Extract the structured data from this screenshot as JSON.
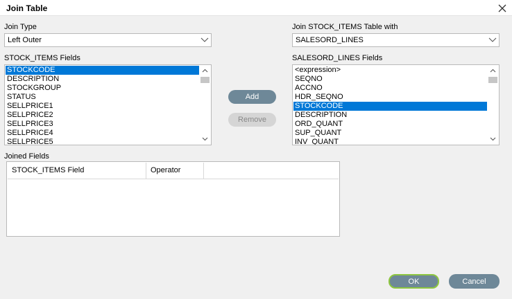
{
  "window": {
    "title": "Join Table",
    "close_icon": "close-icon"
  },
  "join_type": {
    "label": "Join Type",
    "value": "Left Outer"
  },
  "join_with": {
    "label": "Join STOCK_ITEMS Table with",
    "value": "SALESORD_LINES"
  },
  "left_fields": {
    "label": "STOCK_ITEMS Fields",
    "items": [
      "STOCKCODE",
      "DESCRIPTION",
      "STOCKGROUP",
      "STATUS",
      "SELLPRICE1",
      "SELLPRICE2",
      "SELLPRICE3",
      "SELLPRICE4",
      "SELLPRICE5"
    ],
    "selected_index": 0
  },
  "right_fields": {
    "label": "SALESORD_LINES Fields",
    "items": [
      "<expression>",
      "SEQNO",
      "ACCNO",
      "HDR_SEQNO",
      "STOCKCODE",
      "DESCRIPTION",
      "ORD_QUANT",
      "SUP_QUANT",
      "INV_QUANT"
    ],
    "selected_index": 4
  },
  "buttons": {
    "add": "Add",
    "remove": "Remove",
    "ok": "OK",
    "cancel": "Cancel"
  },
  "joined_fields": {
    "label": "Joined Fields",
    "columns": [
      "STOCK_ITEMS Field",
      "Operator"
    ],
    "rows": []
  },
  "colors": {
    "selection": "#0078d7",
    "button": "#6e8898",
    "ok_border": "#8dc63f"
  }
}
